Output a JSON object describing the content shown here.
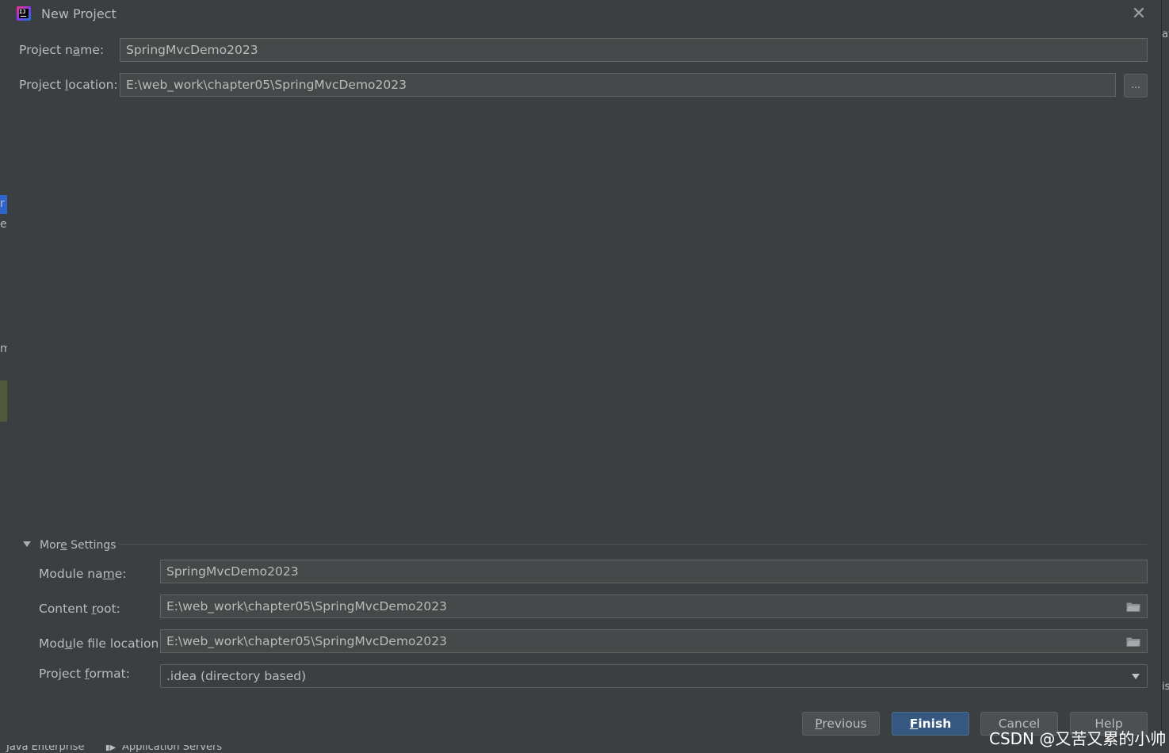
{
  "window": {
    "title": "New Project",
    "close_glyph": "✕"
  },
  "form": {
    "project_name": {
      "label_pre": "Project n",
      "label_mnemonic": "a",
      "label_post": "me:",
      "value": "SpringMvcDemo2023"
    },
    "project_location": {
      "label_pre": "Project ",
      "label_mnemonic": "l",
      "label_post": "ocation:",
      "value": "E:\\web_work\\chapter05\\SpringMvcDemo2023",
      "browse_label": "..."
    }
  },
  "more_settings": {
    "label_pre": "Mor",
    "label_mnemonic": "e",
    "label_post": " Settings",
    "expanded": true,
    "module_name": {
      "label_pre": "Module na",
      "label_mnemonic": "m",
      "label_post": "e:",
      "value": "SpringMvcDemo2023"
    },
    "content_root": {
      "label_pre": "Content ",
      "label_mnemonic": "r",
      "label_post": "oot:",
      "value": "E:\\web_work\\chapter05\\SpringMvcDemo2023",
      "icon": "folder-icon"
    },
    "module_file_location": {
      "label_pre": "Mod",
      "label_mnemonic": "u",
      "label_post": "le file location:",
      "value": "E:\\web_work\\chapter05\\SpringMvcDemo2023",
      "icon": "folder-icon"
    },
    "project_format": {
      "label_pre": "Project ",
      "label_mnemonic": "f",
      "label_post": "ormat:",
      "value": ".idea (directory based)"
    }
  },
  "buttons": {
    "previous": {
      "mnemonic": "P",
      "rest": "revious"
    },
    "finish": {
      "mnemonic": "F",
      "rest": "inish"
    },
    "cancel": "Cancel",
    "help": "Help"
  },
  "background": {
    "bottom_tabs": [
      "Java Enterprise",
      "Application Servers"
    ],
    "left_fragments": [
      "r",
      "e",
      "m"
    ],
    "right_fragments": [
      "av",
      "is"
    ]
  },
  "watermark": "CSDN @又苦又累的小帅",
  "colors": {
    "dialog_bg": "#3c3f41",
    "field_bg": "#45494a",
    "primary_button": "#365880",
    "text": "#bbbbbb"
  }
}
